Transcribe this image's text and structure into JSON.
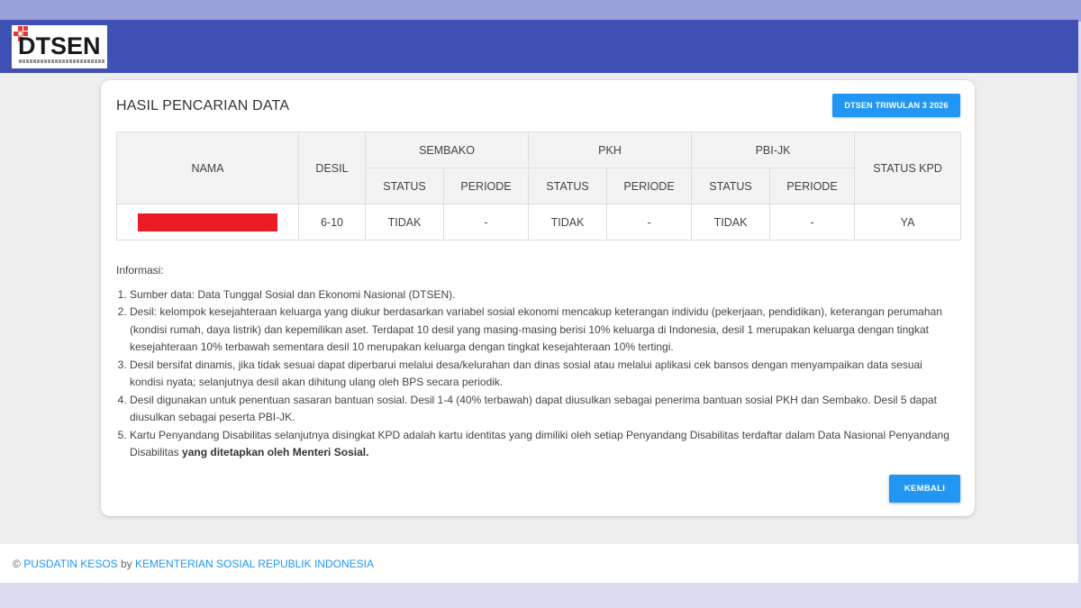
{
  "app": {
    "logo_text": "DTSEN",
    "logo_tagline": "Data Tunggal Sosial dan Ekonomi Nasional"
  },
  "colors": {
    "header": "#3f51b5",
    "accent": "#2196f3",
    "redaction": "#ec1c24"
  },
  "card": {
    "title": "HASIL PENCARIAN DATA",
    "badge_label": "DTSEN TRIWULAN 3 2026"
  },
  "table": {
    "headers": {
      "nama": "NAMA",
      "desil": "DESIL",
      "sembako": "SEMBAKO",
      "pkh": "PKH",
      "pbi_jk": "PBI-JK",
      "status_kpd": "STATUS KPD",
      "status": "STATUS",
      "periode": "PERIODE"
    },
    "rows": [
      {
        "nama": "",
        "desil": "6-10",
        "sembako_status": "TIDAK",
        "sembako_periode": "-",
        "pkh_status": "TIDAK",
        "pkh_periode": "-",
        "pbi_status": "TIDAK",
        "pbi_periode": "-",
        "status_kpd": "YA"
      }
    ]
  },
  "info": {
    "heading": "Informasi:",
    "items": [
      "Sumber data: Data Tunggal Sosial dan Ekonomi Nasional (DTSEN).",
      "Desil: kelompok kesejahteraan keluarga yang diukur berdasarkan variabel sosial ekonomi mencakup keterangan individu (pekerjaan, pendidikan), keterangan perumahan (kondisi rumah, daya listrik) dan kepemilikan aset. Terdapat 10 desil yang masing-masing berisi 10% keluarga di Indonesia, desil 1 merupakan keluarga dengan tingkat kesejahteraan 10% terbawah sementara desil 10 merupakan keluarga dengan tingkat kesejahteraan 10% tertingi.",
      "Desil bersifat dinamis, jika tidak sesuai dapat diperbarui melalui desa/kelurahan dan dinas sosial atau melalui aplikasi cek bansos dengan menyampaikan data sesuai kondisi nyata; selanjutnya desil akan dihitung ulang oleh BPS secara periodik.",
      "Desil digunakan untuk penentuan sasaran bantuan sosial. Desil 1-4 (40% terbawah) dapat diusulkan sebagai penerima bantuan sosial PKH dan Sembako. Desil 5 dapat diusulkan sebagai peserta PBI-JK.",
      "Kartu Penyandang Disabilitas selanjutnya disingkat KPD adalah kartu identitas yang dimiliki oleh setiap Penyandang Disabilitas terdaftar dalam Data Nasional Penyandang Disabilitas"
    ],
    "item5_bold": "yang ditetapkan oleh Menteri Sosial."
  },
  "actions": {
    "back_label": "KEMBALI"
  },
  "footer": {
    "copyright": "©",
    "org_link": "PUSDATIN KESOS",
    "by": "by",
    "ministry_link": "KEMENTERIAN SOSIAL REPUBLIK INDONESIA"
  }
}
